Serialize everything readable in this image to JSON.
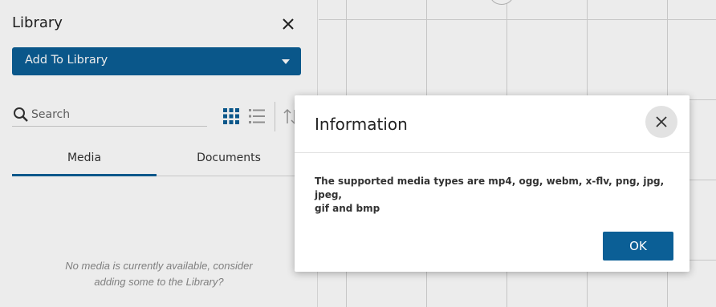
{
  "library": {
    "title": "Library",
    "add_button_label": "Add To Library",
    "search_placeholder": "Search",
    "tabs": [
      {
        "label": "Media",
        "active": true
      },
      {
        "label": "Documents",
        "active": false
      }
    ],
    "empty_message_line1": "No media is currently available, consider",
    "empty_message_line2": "adding some to the Library?"
  },
  "dialog": {
    "title": "Information",
    "message_line1": "The supported media types are mp4, ogg, webm, x-flv, png, jpg, jpeg,",
    "message_line2": "gif and bmp",
    "ok_label": "OK"
  },
  "colors": {
    "accent": "#0b5f96",
    "grid_line": "#d6d6d6"
  },
  "icons": [
    "close-icon",
    "chevron-down-icon",
    "search-icon",
    "grid-view-icon",
    "list-view-icon",
    "sort-icon"
  ]
}
